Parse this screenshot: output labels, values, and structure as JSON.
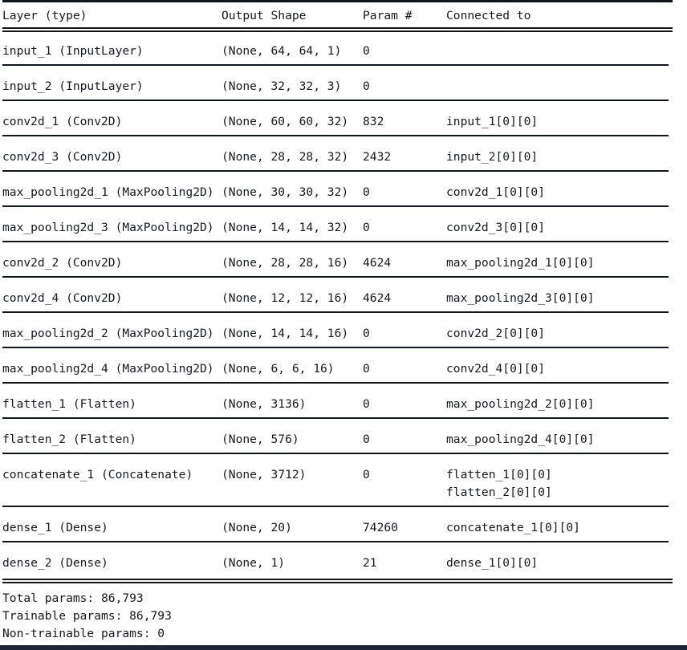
{
  "header": {
    "layer": "Layer (type)",
    "shape": "Output Shape",
    "param": "Param #",
    "connected": "Connected to"
  },
  "rows": [
    {
      "layer": "input_1 (InputLayer)",
      "shape": "(None, 64, 64, 1)",
      "param": "0",
      "connected": [
        "",
        ""
      ]
    },
    {
      "layer": "input_2 (InputLayer)",
      "shape": "(None, 32, 32, 3)",
      "param": "0",
      "connected": [
        "",
        ""
      ]
    },
    {
      "layer": "conv2d_1 (Conv2D)",
      "shape": "(None, 60, 60, 32)",
      "param": "832",
      "connected": [
        "input_1[0][0]",
        ""
      ]
    },
    {
      "layer": "conv2d_3 (Conv2D)",
      "shape": "(None, 28, 28, 32)",
      "param": "2432",
      "connected": [
        "input_2[0][0]",
        ""
      ]
    },
    {
      "layer": "max_pooling2d_1 (MaxPooling2D)",
      "shape": "(None, 30, 30, 32)",
      "param": "0",
      "connected": [
        "conv2d_1[0][0]",
        ""
      ]
    },
    {
      "layer": "max_pooling2d_3 (MaxPooling2D)",
      "shape": "(None, 14, 14, 32)",
      "param": "0",
      "connected": [
        "conv2d_3[0][0]",
        ""
      ]
    },
    {
      "layer": "conv2d_2 (Conv2D)",
      "shape": "(None, 28, 28, 16)",
      "param": "4624",
      "connected": [
        "max_pooling2d_1[0][0]",
        ""
      ]
    },
    {
      "layer": "conv2d_4 (Conv2D)",
      "shape": "(None, 12, 12, 16)",
      "param": "4624",
      "connected": [
        "max_pooling2d_3[0][0]",
        ""
      ]
    },
    {
      "layer": "max_pooling2d_2 (MaxPooling2D)",
      "shape": "(None, 14, 14, 16)",
      "param": "0",
      "connected": [
        "conv2d_2[0][0]",
        ""
      ]
    },
    {
      "layer": "max_pooling2d_4 (MaxPooling2D)",
      "shape": "(None, 6, 6, 16)",
      "param": "0",
      "connected": [
        "conv2d_4[0][0]",
        ""
      ]
    },
    {
      "layer": "flatten_1 (Flatten)",
      "shape": "(None, 3136)",
      "param": "0",
      "connected": [
        "max_pooling2d_2[0][0]",
        ""
      ]
    },
    {
      "layer": "flatten_2 (Flatten)",
      "shape": "(None, 576)",
      "param": "0",
      "connected": [
        "max_pooling2d_4[0][0]",
        ""
      ]
    },
    {
      "layer": "concatenate_1 (Concatenate)",
      "shape": "(None, 3712)",
      "param": "0",
      "connected": [
        "flatten_1[0][0]",
        "flatten_2[0][0]"
      ]
    },
    {
      "layer": "dense_1 (Dense)",
      "shape": "(None, 20)",
      "param": "74260",
      "connected": [
        "concatenate_1[0][0]",
        ""
      ]
    },
    {
      "layer": "dense_2 (Dense)",
      "shape": "(None, 1)",
      "param": "21",
      "connected": [
        "dense_1[0][0]",
        ""
      ]
    }
  ],
  "totals": {
    "total": "Total params: 86,793",
    "trainable": "Trainable params: 86,793",
    "non_trainable": "Non-trainable params: 0"
  },
  "colors": {
    "text": "#16191d",
    "rule": "#111418",
    "bottom_bar": "#1e2433",
    "background": "#ffffff"
  }
}
